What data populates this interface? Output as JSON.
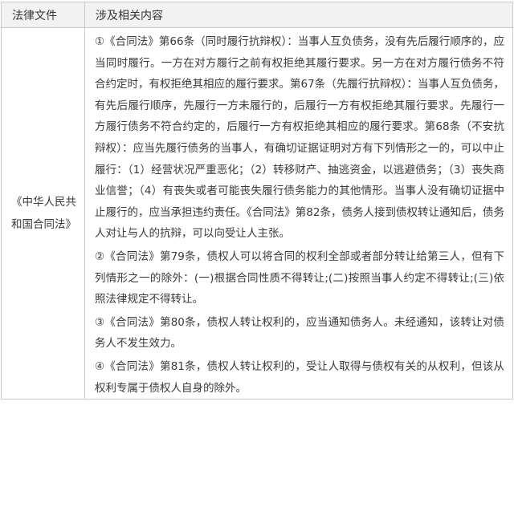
{
  "table": {
    "headers": [
      "法律文件",
      "涉及相关内容"
    ],
    "row": {
      "document": "《中华人民共和国合同法》",
      "paragraphs": [
        "①《合同法》第66条（同时履行抗辩权）：当事人互负债务，没有先后履行顺序的，应当同时履行。一方在对方履行之前有权拒绝其履行要求。另一方在对方履行债务不符合约定时，有权拒绝其相应的履行要求。第67条（先履行抗辩权）：当事人互负债务，有先后履行顺序，先履行一方未履行的，后履行一方有权拒绝其履行要求。先履行一方履行债务不符合约定的，后履行一方有权拒绝其相应的履行要求。第68条（不安抗辩权）：应当先履行债务的当事人，有确切证据证明对方有下列情形之一的，可以中止履行：（1）经营状况严重恶化；（2）转移财产、抽逃资金，以逃避债务；（3）丧失商业信誉；（4）有丧失或者可能丧失履行债务能力的其他情形。当事人没有确切证据中止履行的，应当承担违约责任。《合同法》第82条，债务人接到债权转让通知后，债务人对让与人的抗辩，可以向受让人主张。",
        "②《合同法》第79条，债权人可以将合同的权利全部或者部分转让给第三人，但有下列情形之一的除外：(一)根据合同性质不得转让;(二)按照当事人约定不得转让;(三)依照法律规定不得转让。",
        "③《合同法》第80条，债权人转让权利的，应当通知债务人。未经通知，该转让对债务人不发生效力。",
        "④《合同法》第81条，债权人转让权利的，受让人取得与债权有关的从权利，但该从权利专属于债权人自身的除外。"
      ]
    }
  }
}
